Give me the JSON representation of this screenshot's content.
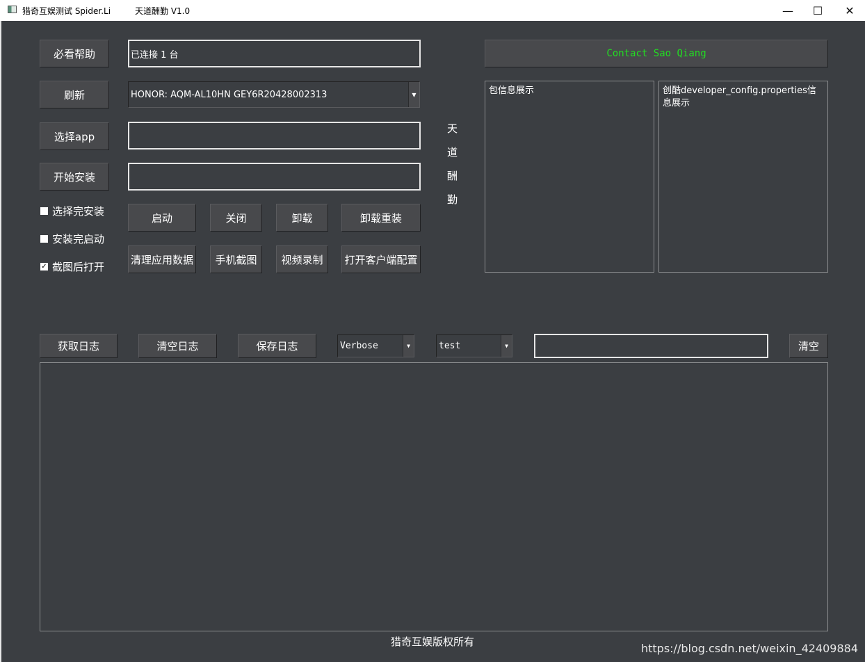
{
  "window": {
    "title": "猎奇互娱测试 Spider.Li",
    "version_label": "天道酬勤  V1.0",
    "minimize": "—",
    "maximize": "☐",
    "close": "✕"
  },
  "left_buttons": {
    "help": "必看帮助",
    "refresh": "刷新",
    "select_app": "选择app",
    "start_install": "开始安装"
  },
  "fields": {
    "connection_status": "已连接 1 台",
    "device_select": "HONOR: AQM-AL10HN GEY6R20428002313",
    "app_path": "",
    "install_status": ""
  },
  "checkboxes": [
    {
      "label": "选择完安装",
      "checked": false
    },
    {
      "label": "安装完启动",
      "checked": false
    },
    {
      "label": "截图后打开",
      "checked": true
    }
  ],
  "action_buttons": {
    "launch": "启动",
    "close": "关闭",
    "uninstall": "卸载",
    "reinstall": "卸载重装",
    "clear_data": "清理应用数据",
    "screenshot": "手机截图",
    "record": "视频录制",
    "open_config": "打开客户端配置"
  },
  "vertical_motto": [
    "天",
    "道",
    "酬",
    "勤"
  ],
  "contact": {
    "label": "Contact Sao Qiang",
    "color": "#22dd22"
  },
  "panels": {
    "package_info": "包信息展示",
    "developer_config": "创酷developer_config.properties信息展示"
  },
  "log_toolbar": {
    "get_log": "获取日志",
    "clear_log": "清空日志",
    "save_log": "保存日志",
    "level_select": "Verbose",
    "tag_select": "test",
    "filter_value": "",
    "clear": "清空"
  },
  "footer": "猎奇互娱版权所有",
  "watermark": "https://blog.csdn.net/weixin_42409884"
}
